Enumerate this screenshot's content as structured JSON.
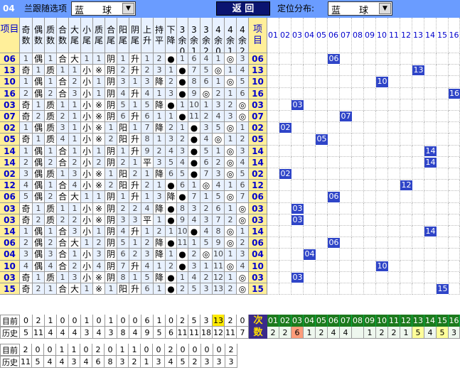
{
  "toolbar": {
    "issue": "04",
    "filter_label": "兰跟随选项",
    "filter_value": "蓝　　球",
    "return_label": "返 回",
    "dist_label": "定位分布:",
    "dist_value": "蓝　　球"
  },
  "headers": {
    "item": "项目",
    "cols": [
      "奇数",
      "偶数",
      "质数",
      "合数",
      "大尾",
      "小尾",
      "质尾",
      "合尾",
      "阳尾",
      "阴尾",
      "上升",
      "持平",
      "下降",
      "3余0",
      "3余1",
      "3余2",
      "4余0",
      "4余1",
      "4余2",
      "4余3"
    ],
    "item2": "项目",
    "dist": [
      "01",
      "02",
      "03",
      "04",
      "05",
      "06",
      "07",
      "08",
      "09",
      "10",
      "11",
      "12",
      "13",
      "14",
      "15",
      "16"
    ]
  },
  "rows": [
    [
      "06",
      "1",
      "偶",
      "1",
      "合",
      "大",
      "1",
      "1",
      "阴",
      "1",
      "升",
      "1",
      "2",
      "●",
      "1",
      "6",
      "4",
      "1",
      "◎",
      "3"
    ],
    [
      "13",
      "奇",
      "1",
      "质",
      "1",
      "1",
      "小",
      "※",
      "阴",
      "2",
      "升",
      "2",
      "3",
      "1",
      "●",
      "7",
      "5",
      "◎",
      "1",
      "4"
    ],
    [
      "10",
      "1",
      "偶",
      "1",
      "合",
      "2",
      "小",
      "1",
      "阴",
      "3",
      "1",
      "3",
      "降",
      "2",
      "●",
      "8",
      "6",
      "1",
      "◎",
      "5"
    ],
    [
      "16",
      "2",
      "偶",
      "2",
      "合",
      "3",
      "小",
      "1",
      "阴",
      "4",
      "升",
      "4",
      "1",
      "3",
      "●",
      "9",
      "◎",
      "2",
      "1",
      "6"
    ],
    [
      "03",
      "奇",
      "1",
      "质",
      "1",
      "1",
      "小",
      "※",
      "阴",
      "5",
      "1",
      "5",
      "降",
      "●",
      "1",
      "10",
      "1",
      "3",
      "2",
      "◎"
    ],
    [
      "07",
      "奇",
      "2",
      "质",
      "2",
      "1",
      "小",
      "※",
      "阴",
      "6",
      "升",
      "6",
      "1",
      "1",
      "●",
      "11",
      "2",
      "4",
      "3",
      "◎"
    ],
    [
      "02",
      "1",
      "偶",
      "质",
      "3",
      "1",
      "小",
      "※",
      "1",
      "阳",
      "1",
      "7",
      "降",
      "2",
      "1",
      "●",
      "3",
      "5",
      "◎",
      "1"
    ],
    [
      "05",
      "奇",
      "1",
      "质",
      "4",
      "1",
      "小",
      "※",
      "2",
      "阳",
      "升",
      "8",
      "1",
      "3",
      "2",
      "●",
      "4",
      "◎",
      "1",
      "2"
    ],
    [
      "14",
      "1",
      "偶",
      "1",
      "合",
      "1",
      "小",
      "1",
      "阴",
      "1",
      "升",
      "9",
      "2",
      "4",
      "3",
      "●",
      "5",
      "1",
      "◎",
      "3"
    ],
    [
      "14",
      "2",
      "偶",
      "2",
      "合",
      "2",
      "小",
      "2",
      "阴",
      "2",
      "1",
      "平",
      "3",
      "5",
      "4",
      "●",
      "6",
      "2",
      "◎",
      "4"
    ],
    [
      "02",
      "3",
      "偶",
      "质",
      "1",
      "3",
      "小",
      "※",
      "1",
      "阳",
      "2",
      "1",
      "降",
      "6",
      "5",
      "●",
      "7",
      "3",
      "◎",
      "5"
    ],
    [
      "12",
      "4",
      "偶",
      "1",
      "合",
      "4",
      "小",
      "※",
      "2",
      "阳",
      "升",
      "2",
      "1",
      "●",
      "6",
      "1",
      "◎",
      "4",
      "1",
      "6"
    ],
    [
      "06",
      "5",
      "偶",
      "2",
      "合",
      "大",
      "1",
      "1",
      "阴",
      "1",
      "升",
      "1",
      "3",
      "降",
      "●",
      "7",
      "1",
      "5",
      "◎",
      "7"
    ],
    [
      "03",
      "奇",
      "1",
      "质",
      "1",
      "1",
      "小",
      "※",
      "阴",
      "2",
      "2",
      "4",
      "降",
      "●",
      "8",
      "3",
      "2",
      "6",
      "1",
      "◎"
    ],
    [
      "03",
      "奇",
      "2",
      "质",
      "2",
      "2",
      "小",
      "※",
      "阴",
      "3",
      "3",
      "平",
      "1",
      "●",
      "9",
      "4",
      "3",
      "7",
      "2",
      "◎"
    ],
    [
      "14",
      "1",
      "偶",
      "1",
      "合",
      "3",
      "小",
      "1",
      "阴",
      "4",
      "升",
      "1",
      "2",
      "1",
      "10",
      "●",
      "4",
      "8",
      "◎",
      "1"
    ],
    [
      "06",
      "2",
      "偶",
      "2",
      "合",
      "大",
      "1",
      "2",
      "阴",
      "5",
      "1",
      "2",
      "降",
      "●",
      "11",
      "1",
      "5",
      "9",
      "◎",
      "2"
    ],
    [
      "04",
      "3",
      "偶",
      "3",
      "合",
      "1",
      "小",
      "3",
      "阴",
      "6",
      "2",
      "3",
      "降",
      "1",
      "●",
      "2",
      "◎",
      "10",
      "1",
      "3"
    ],
    [
      "10",
      "4",
      "偶",
      "4",
      "合",
      "2",
      "小",
      "4",
      "阴",
      "7",
      "升",
      "4",
      "1",
      "2",
      "●",
      "3",
      "1",
      "11",
      "◎",
      "4"
    ],
    [
      "03",
      "奇",
      "1",
      "质",
      "1",
      "3",
      "小",
      "※",
      "阴",
      "8",
      "1",
      "5",
      "降",
      "●",
      "1",
      "4",
      "2",
      "12",
      "1",
      "◎"
    ],
    [
      "15",
      "奇",
      "2",
      "1",
      "合",
      "大",
      "1",
      "※",
      "1",
      "阳",
      "升",
      "6",
      "1",
      "●",
      "2",
      "5",
      "3",
      "13",
      "2",
      "◎"
    ]
  ],
  "dist_pos": [
    6,
    13,
    10,
    16,
    3,
    7,
    2,
    5,
    14,
    14,
    2,
    12,
    6,
    3,
    3,
    14,
    6,
    4,
    10,
    3,
    15
  ],
  "stats": {
    "lbl_now": "目前",
    "lbl_hist": "历史",
    "now1": [
      "0",
      "2",
      "1",
      "0",
      "0",
      "1",
      "0",
      "1",
      "0",
      "0",
      "6",
      "1",
      "0",
      "2",
      "5",
      "3",
      "13",
      "2",
      "0"
    ],
    "hist1": [
      "5",
      "11",
      "4",
      "4",
      "4",
      "3",
      "4",
      "3",
      "8",
      "4",
      "9",
      "5",
      "6",
      "11",
      "11",
      "18",
      "12",
      "11",
      "7"
    ],
    "ci_label": "次数",
    "ci_nums": [
      "01",
      "02",
      "03",
      "04",
      "05",
      "06",
      "07",
      "08",
      "09",
      "10",
      "11",
      "12",
      "13",
      "14",
      "15",
      "16"
    ],
    "ci_vals": [
      "2",
      "2",
      "6",
      "1",
      "2",
      "4",
      "4",
      "",
      "1",
      "2",
      "2",
      "1",
      "5",
      "4",
      "5",
      "3"
    ],
    "now2": [
      "2",
      "0",
      "0",
      "1",
      "1",
      "0",
      "2",
      "0",
      "1",
      "1",
      "0",
      "0",
      "2",
      "0",
      "0",
      "0",
      "0",
      "2"
    ],
    "hist2": [
      "11",
      "5",
      "4",
      "4",
      "3",
      "4",
      "6",
      "8",
      "3",
      "2",
      "1",
      "3",
      "4",
      "5",
      "2",
      "3",
      "3",
      "3"
    ]
  },
  "colors": {
    "item_bg": "#ffef9a",
    "item_text": "#0000cc",
    "cell_bg": "#e8f1ff",
    "blue_bg": "#2f45c8",
    "blue_text": "#fff",
    "green_bg": "#1d7a1d",
    "ci_bg": "#3a2a8a",
    "ci_text": "#ffdd00",
    "hl_yellow": "#ffea00",
    "hl_pink": "#ff9c7a"
  }
}
